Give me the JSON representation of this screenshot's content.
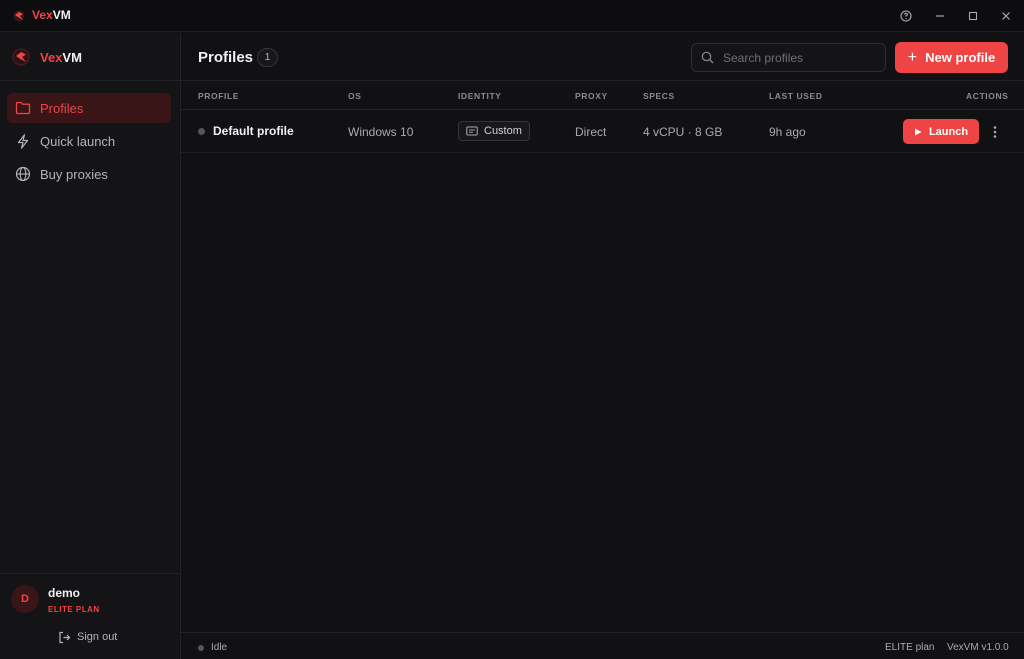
{
  "app": {
    "brand_part1": "Vex",
    "brand_part2": "VM",
    "accent_color": "#ef4444"
  },
  "titlebar": {
    "icons": [
      "help-icon",
      "minimize-icon",
      "maximize-icon",
      "close-icon"
    ]
  },
  "sidebar": {
    "items": [
      {
        "label": "Profiles",
        "icon": "folder-icon",
        "active": true
      },
      {
        "label": "Quick launch",
        "icon": "lightning-icon",
        "active": false
      },
      {
        "label": "Buy proxies",
        "icon": "globe-icon",
        "active": false
      }
    ],
    "user": {
      "initial": "D",
      "name": "demo",
      "plan": "ELITE PLAN"
    },
    "signout_label": "Sign out"
  },
  "main": {
    "title": "Profiles",
    "count": "1",
    "search_placeholder": "Search profiles",
    "new_button": "New profile",
    "columns": [
      "PROFILE",
      "OS",
      "IDENTITY",
      "PROXY",
      "SPECS",
      "LAST USED",
      "ACTIONS"
    ],
    "rows": [
      {
        "name": "Default profile",
        "os": "Windows 10",
        "identity": "Custom",
        "proxy": "Direct",
        "specs": "4 vCPU · 8 GB",
        "last_used": "9h ago",
        "action": "Launch"
      }
    ]
  },
  "statusbar": {
    "status": "Idle",
    "plan": "ELITE plan",
    "version": "VexVM v1.0.0"
  }
}
